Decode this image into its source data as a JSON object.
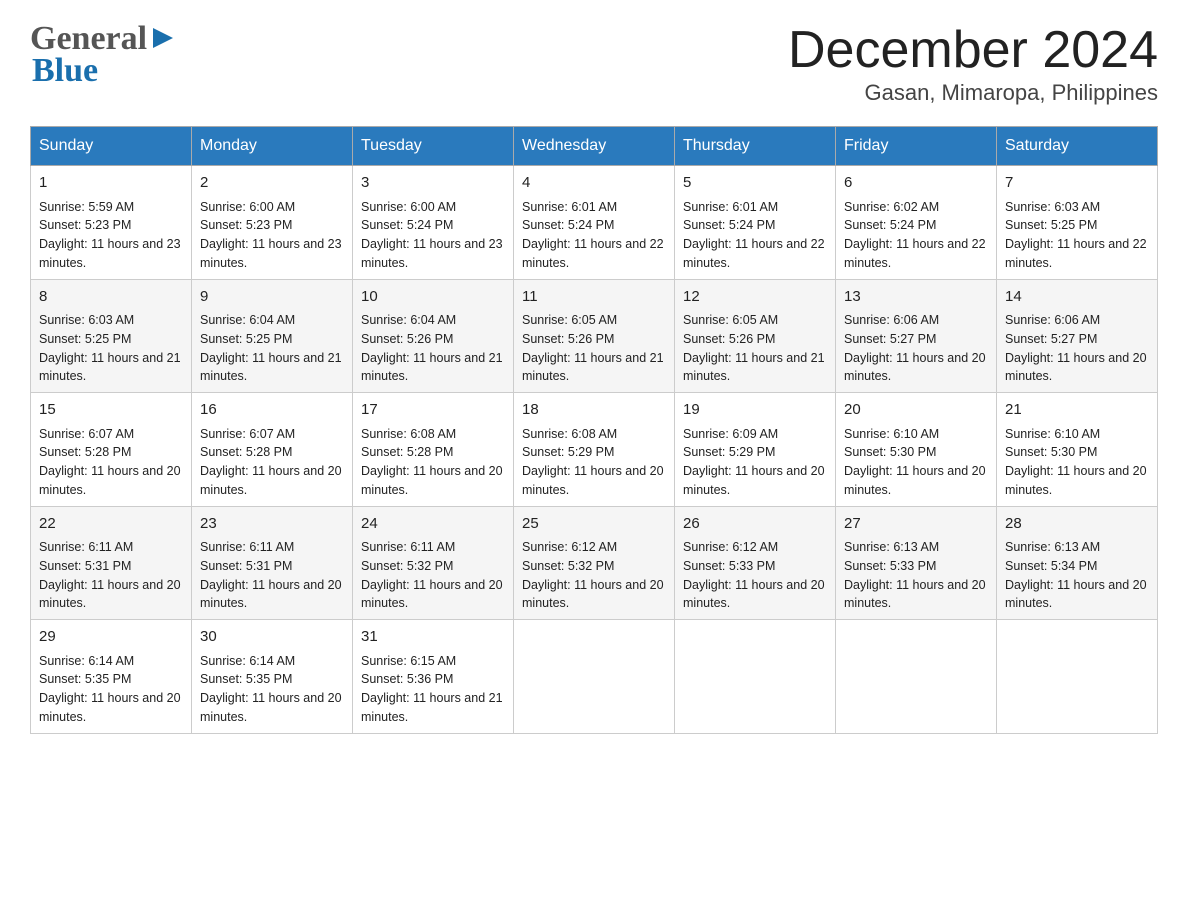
{
  "header": {
    "logo_general": "General",
    "logo_blue": "Blue",
    "title": "December 2024",
    "subtitle": "Gasan, Mimaropa, Philippines"
  },
  "days_of_week": [
    "Sunday",
    "Monday",
    "Tuesday",
    "Wednesday",
    "Thursday",
    "Friday",
    "Saturday"
  ],
  "weeks": [
    [
      {
        "day": "1",
        "sunrise": "5:59 AM",
        "sunset": "5:23 PM",
        "daylight": "11 hours and 23 minutes."
      },
      {
        "day": "2",
        "sunrise": "6:00 AM",
        "sunset": "5:23 PM",
        "daylight": "11 hours and 23 minutes."
      },
      {
        "day": "3",
        "sunrise": "6:00 AM",
        "sunset": "5:24 PM",
        "daylight": "11 hours and 23 minutes."
      },
      {
        "day": "4",
        "sunrise": "6:01 AM",
        "sunset": "5:24 PM",
        "daylight": "11 hours and 22 minutes."
      },
      {
        "day": "5",
        "sunrise": "6:01 AM",
        "sunset": "5:24 PM",
        "daylight": "11 hours and 22 minutes."
      },
      {
        "day": "6",
        "sunrise": "6:02 AM",
        "sunset": "5:24 PM",
        "daylight": "11 hours and 22 minutes."
      },
      {
        "day": "7",
        "sunrise": "6:03 AM",
        "sunset": "5:25 PM",
        "daylight": "11 hours and 22 minutes."
      }
    ],
    [
      {
        "day": "8",
        "sunrise": "6:03 AM",
        "sunset": "5:25 PM",
        "daylight": "11 hours and 21 minutes."
      },
      {
        "day": "9",
        "sunrise": "6:04 AM",
        "sunset": "5:25 PM",
        "daylight": "11 hours and 21 minutes."
      },
      {
        "day": "10",
        "sunrise": "6:04 AM",
        "sunset": "5:26 PM",
        "daylight": "11 hours and 21 minutes."
      },
      {
        "day": "11",
        "sunrise": "6:05 AM",
        "sunset": "5:26 PM",
        "daylight": "11 hours and 21 minutes."
      },
      {
        "day": "12",
        "sunrise": "6:05 AM",
        "sunset": "5:26 PM",
        "daylight": "11 hours and 21 minutes."
      },
      {
        "day": "13",
        "sunrise": "6:06 AM",
        "sunset": "5:27 PM",
        "daylight": "11 hours and 20 minutes."
      },
      {
        "day": "14",
        "sunrise": "6:06 AM",
        "sunset": "5:27 PM",
        "daylight": "11 hours and 20 minutes."
      }
    ],
    [
      {
        "day": "15",
        "sunrise": "6:07 AM",
        "sunset": "5:28 PM",
        "daylight": "11 hours and 20 minutes."
      },
      {
        "day": "16",
        "sunrise": "6:07 AM",
        "sunset": "5:28 PM",
        "daylight": "11 hours and 20 minutes."
      },
      {
        "day": "17",
        "sunrise": "6:08 AM",
        "sunset": "5:28 PM",
        "daylight": "11 hours and 20 minutes."
      },
      {
        "day": "18",
        "sunrise": "6:08 AM",
        "sunset": "5:29 PM",
        "daylight": "11 hours and 20 minutes."
      },
      {
        "day": "19",
        "sunrise": "6:09 AM",
        "sunset": "5:29 PM",
        "daylight": "11 hours and 20 minutes."
      },
      {
        "day": "20",
        "sunrise": "6:10 AM",
        "sunset": "5:30 PM",
        "daylight": "11 hours and 20 minutes."
      },
      {
        "day": "21",
        "sunrise": "6:10 AM",
        "sunset": "5:30 PM",
        "daylight": "11 hours and 20 minutes."
      }
    ],
    [
      {
        "day": "22",
        "sunrise": "6:11 AM",
        "sunset": "5:31 PM",
        "daylight": "11 hours and 20 minutes."
      },
      {
        "day": "23",
        "sunrise": "6:11 AM",
        "sunset": "5:31 PM",
        "daylight": "11 hours and 20 minutes."
      },
      {
        "day": "24",
        "sunrise": "6:11 AM",
        "sunset": "5:32 PM",
        "daylight": "11 hours and 20 minutes."
      },
      {
        "day": "25",
        "sunrise": "6:12 AM",
        "sunset": "5:32 PM",
        "daylight": "11 hours and 20 minutes."
      },
      {
        "day": "26",
        "sunrise": "6:12 AM",
        "sunset": "5:33 PM",
        "daylight": "11 hours and 20 minutes."
      },
      {
        "day": "27",
        "sunrise": "6:13 AM",
        "sunset": "5:33 PM",
        "daylight": "11 hours and 20 minutes."
      },
      {
        "day": "28",
        "sunrise": "6:13 AM",
        "sunset": "5:34 PM",
        "daylight": "11 hours and 20 minutes."
      }
    ],
    [
      {
        "day": "29",
        "sunrise": "6:14 AM",
        "sunset": "5:35 PM",
        "daylight": "11 hours and 20 minutes."
      },
      {
        "day": "30",
        "sunrise": "6:14 AM",
        "sunset": "5:35 PM",
        "daylight": "11 hours and 20 minutes."
      },
      {
        "day": "31",
        "sunrise": "6:15 AM",
        "sunset": "5:36 PM",
        "daylight": "11 hours and 21 minutes."
      },
      null,
      null,
      null,
      null
    ]
  ],
  "colors": {
    "header_bg": "#2a7abd",
    "accent": "#1a6fad"
  }
}
